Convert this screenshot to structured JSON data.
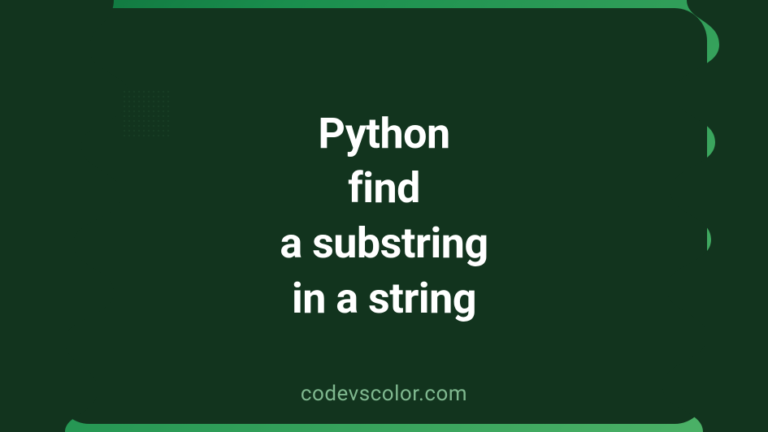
{
  "banner": {
    "title_lines": {
      "line1": "Python",
      "line2": "find",
      "line3": "a substring",
      "line4": "in a string"
    },
    "subtitle": "codevscolor.com",
    "colors": {
      "dark_panel": "#12341e",
      "gradient_start": "#0d6e3a",
      "gradient_end": "#5cb56e",
      "text": "#ffffff",
      "subtitle_text": "#7fb88f"
    }
  }
}
